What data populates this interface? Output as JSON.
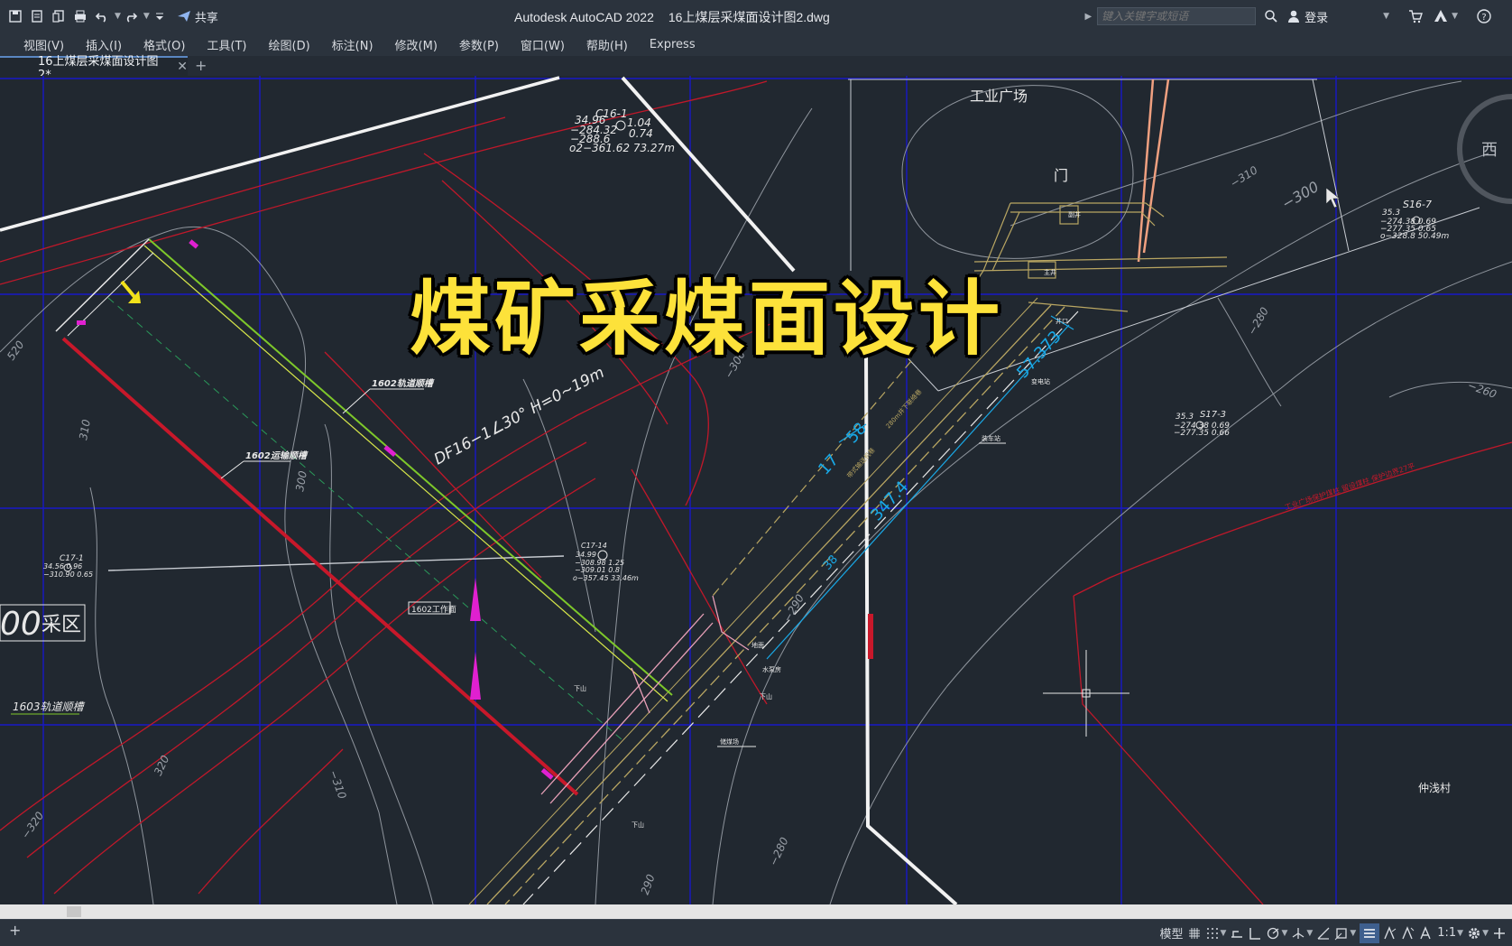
{
  "titlebar": {
    "share_label": "共享",
    "app_name": "Autodesk AutoCAD 2022",
    "file_name": "16上煤层采煤面设计图2.dwg",
    "search_placeholder": "键入关键字或短语",
    "login_label": "登录"
  },
  "menu": {
    "items": [
      "视图(V)",
      "插入(I)",
      "格式(O)",
      "工具(T)",
      "绘图(D)",
      "标注(N)",
      "修改(M)",
      "参数(P)",
      "窗口(W)",
      "帮助(H)",
      "Express"
    ]
  },
  "tabs": {
    "active_label": "16上煤层采煤面设计图2*",
    "close_glyph": "✕",
    "new_glyph": "+"
  },
  "overlay": {
    "title": "煤矿采煤面设计"
  },
  "drawing": {
    "labels": {
      "industrial_square": "工业广场",
      "gate_mark": "门",
      "west": "西",
      "borehole_c16": "C16-1",
      "c16_l1": "34.96",
      "c16_l1b": "1.04",
      "c16_l2": "−284.32",
      "c16_l2b": "0.74",
      "c16_l3": "−288.6",
      "c16_l4": "o2−361.62  73.27m",
      "borehole_s16": "S16-7",
      "s16_l1": "35.3",
      "s16_l2": "−274.38  0.69",
      "s16_l3": "−277.35  0.65",
      "s16_l4": "o−328.8  50.49m",
      "borehole_s17": "S17-3",
      "s17_l1": "35.3",
      "s17_l2": "−274.38  0.69",
      "s17_l3": "−277.35  0.66",
      "borehole_c17_1": "C17-1",
      "c17_1_l1": "34.56  0.96",
      "c17_1_l2": "−310.90  0.65",
      "borehole_c17_14": "C17-14",
      "c17_14_l1": "34.99",
      "c17_14_l2": "−308.98  1.25",
      "c17_14_l3": "−309.01  0.8",
      "c17_14_l4": "o−357.45  33.46m",
      "fault": "DF16−1∠30° H=0~19m",
      "roadway_1602_track": "1602轨道顺槽",
      "roadway_1602_trans": "1602运输顺槽",
      "face_1602": "1602工作面",
      "roadway_1603_track": "1603轨道顺槽",
      "area_big": "00",
      "area_suffix": "采区",
      "village": "仲浅村",
      "dim_347": "347.4",
      "dim_373": "57.373",
      "dim_17": "17",
      "dim_58": "58",
      "dim_38": "38",
      "contour_310a": "−310",
      "contour_300a": "−300",
      "contour_280a": "−280",
      "contour_260": "−260",
      "contour_310b": "310",
      "contour_300b": "300",
      "contour_300c": "−300",
      "contour_290": "−290",
      "contour_320": "320",
      "contour_320b": "−320",
      "contour_310c": "−310",
      "contour_280b": "−280",
      "contour_290b": "290",
      "contour_520": "520",
      "small_main_well": "主井",
      "small_aux": "副井",
      "small_station": "变电站",
      "small_loading": "装车站",
      "small_mine_entry": "井口",
      "small_ground": "地面",
      "small_pump": "水泵房",
      "small_yard": "储煤场",
      "small_down": "下山",
      "small_dist": "280m井下联络巷",
      "small_belt": "带式输送机巷",
      "small_coal_pillar": "工业广场保护煤柱 留设煤柱 保护边界27平"
    }
  },
  "statusbar": {
    "model_label": "模型",
    "scale_label": "1:1"
  },
  "colors": {
    "background": "#212830",
    "grid": "#1414c8",
    "red_line": "#c8182a",
    "green_line": "#7ec82a",
    "yellow_title": "#fde23a",
    "cyan_dim": "#19a8e6",
    "magenta": "#e020d0",
    "salmon": "#f0a080"
  }
}
